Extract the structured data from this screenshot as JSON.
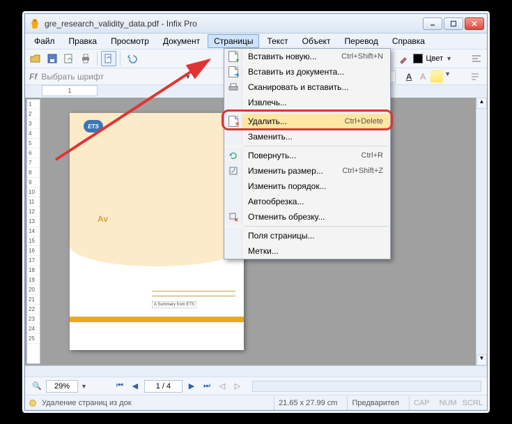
{
  "window": {
    "title": "gre_research_validity_data.pdf - Infix Pro"
  },
  "menubar": {
    "items": [
      "Файл",
      "Правка",
      "Просмотр",
      "Документ",
      "Страницы",
      "Текст",
      "Объект",
      "Перевод",
      "Справка"
    ],
    "active_index": 4
  },
  "fontbar": {
    "placeholder": "Выбрать шрифт"
  },
  "toolbar_right": {
    "color_label": "Цвет"
  },
  "ruler": {
    "first": "1",
    "vticks": [
      "1",
      "2",
      "3",
      "4",
      "5",
      "6",
      "7",
      "8",
      "9",
      "10",
      "11",
      "12",
      "13",
      "14",
      "15",
      "16",
      "17",
      "18",
      "19",
      "20",
      "21",
      "22",
      "23",
      "24",
      "25"
    ]
  },
  "page_preview": {
    "logo": "ETS",
    "big_text": "Av",
    "summary": "A Summary from ETS"
  },
  "dropdown": {
    "items": [
      {
        "label": "Вставить новую...",
        "shortcut": "Ctrl+Shift+N",
        "icon": "doc-plus"
      },
      {
        "label": "Вставить из документа...",
        "shortcut": "",
        "icon": "doc-arrow"
      },
      {
        "label": "Сканировать и вставить...",
        "shortcut": "",
        "icon": "scanner"
      },
      {
        "label": "Извлечь...",
        "shortcut": "",
        "icon": ""
      },
      {
        "label": "Удалить...",
        "shortcut": "Ctrl+Delete",
        "icon": "doc-x",
        "highlight": true
      },
      {
        "label": "Заменить...",
        "shortcut": "",
        "icon": ""
      },
      {
        "label": "Повернуть...",
        "shortcut": "Ctrl+R",
        "icon": "rotate"
      },
      {
        "label": "Изменить размер...",
        "shortcut": "Ctrl+Shift+Z",
        "icon": "resize"
      },
      {
        "label": "Изменить порядок...",
        "shortcut": "",
        "icon": ""
      },
      {
        "label": "Автообрезка...",
        "shortcut": "",
        "icon": ""
      },
      {
        "label": "Отменить обрезку...",
        "shortcut": "",
        "icon": "crop-x"
      },
      {
        "label": "Поля страницы...",
        "shortcut": "",
        "icon": ""
      },
      {
        "label": "Метки...",
        "shortcut": "",
        "icon": ""
      }
    ],
    "dividers_after": [
      3,
      5,
      10
    ]
  },
  "nav": {
    "zoom": "29%",
    "page": "1 / 4"
  },
  "status": {
    "message": "Удаление страниц из док",
    "dims": "21.65 x 27.99 cm",
    "preview": "Предварител",
    "caps": "CAP",
    "num": "NUM",
    "scrl": "SCRL"
  },
  "icons": {
    "ff": "Ff"
  }
}
